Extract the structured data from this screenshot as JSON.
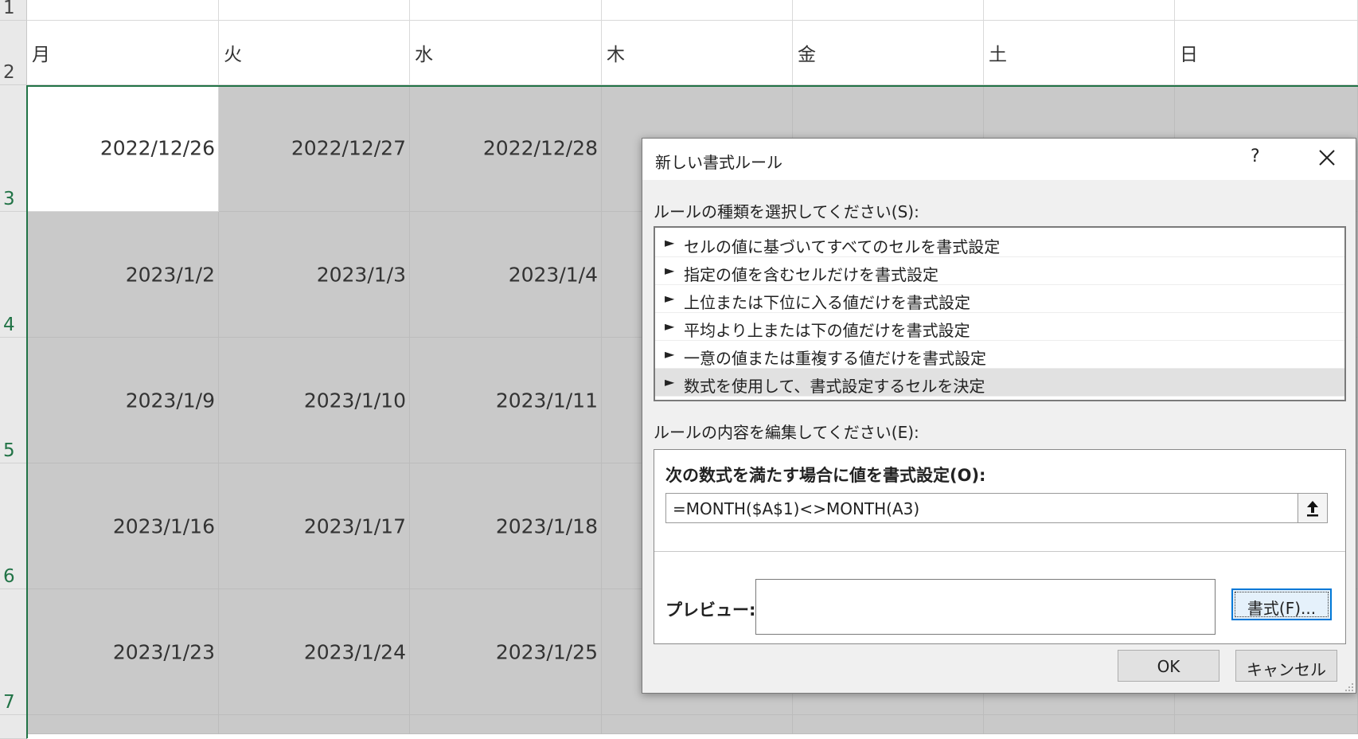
{
  "sheet": {
    "rows": [
      {
        "num": "1"
      },
      {
        "num": "2"
      },
      {
        "num": "3"
      },
      {
        "num": "4"
      },
      {
        "num": "5"
      },
      {
        "num": "6"
      },
      {
        "num": "7"
      }
    ],
    "weekdays": [
      "月",
      "火",
      "水",
      "木",
      "金",
      "土",
      "日"
    ],
    "dates": [
      [
        "2022/12/26",
        "2022/12/27",
        "2022/12/28"
      ],
      [
        "2023/1/2",
        "2023/1/3",
        "2023/1/4"
      ],
      [
        "2023/1/9",
        "2023/1/10",
        "2023/1/11"
      ],
      [
        "2023/1/16",
        "2023/1/17",
        "2023/1/18"
      ],
      [
        "2023/1/23",
        "2023/1/24",
        "2023/1/25"
      ]
    ]
  },
  "dialog": {
    "title": "新しい書式ルール",
    "help": "?",
    "type_label": "ルールの種類を選択してください(S):",
    "rule_types": [
      "セルの値に基づいてすべてのセルを書式設定",
      "指定の値を含むセルだけを書式設定",
      "上位または下位に入る値だけを書式設定",
      "平均より上または下の値だけを書式設定",
      "一意の値または重複する値だけを書式設定",
      "数式を使用して、書式設定するセルを決定"
    ],
    "selected_rule_index": 5,
    "edit_label": "ルールの内容を編集してください(E):",
    "formula_label": "次の数式を満たす場合に値を書式設定(O):",
    "formula_value": "=MONTH($A$1)<>MONTH(A3)",
    "preview_label": "プレビュー:",
    "format_button": "書式(F)...",
    "ok_button": "OK",
    "cancel_button": "キャンセル"
  },
  "colors": {
    "shaded_cell": "#c9c9c9",
    "selection_green": "#217346",
    "focus_blue": "#0078d7"
  }
}
